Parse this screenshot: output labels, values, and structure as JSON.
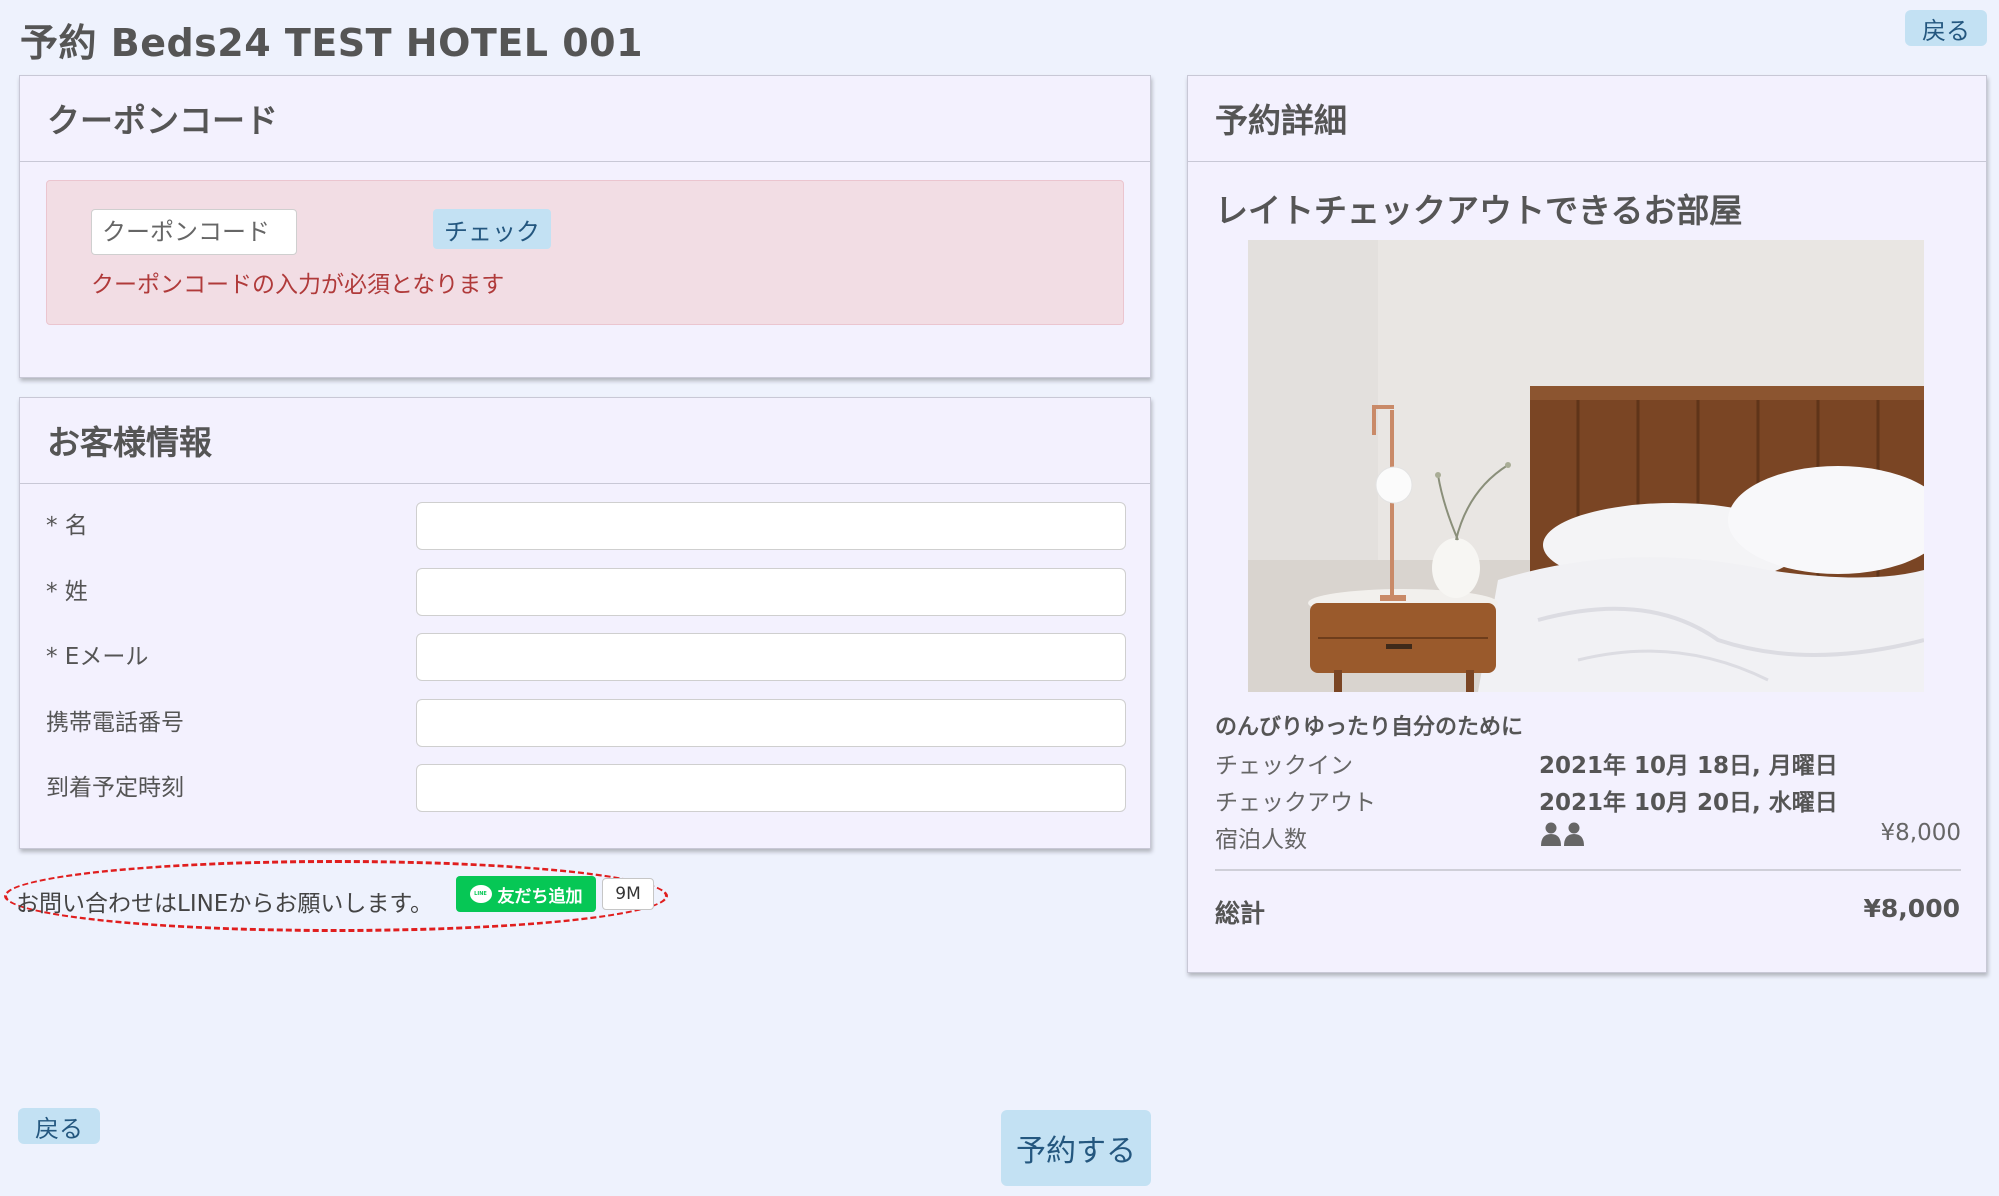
{
  "header": {
    "title": "予約 Beds24 TEST HOTEL 001",
    "back_label": "戻る"
  },
  "coupon": {
    "heading": "クーポンコード",
    "placeholder": "クーポンコード",
    "check_label": "チェック",
    "error": "クーポンコードの入力が必須となります"
  },
  "customer": {
    "heading": "お客様情報",
    "fields": [
      {
        "label": "* 名"
      },
      {
        "label": "* 姓"
      },
      {
        "label": "* Eメール"
      },
      {
        "label": "携帯電話番号"
      },
      {
        "label": "到着予定時刻"
      }
    ]
  },
  "line": {
    "text": "お問い合わせはLINEからお願いします。",
    "button_label": "友だち追加",
    "bubble_text": "LINE",
    "count": "9M"
  },
  "footer": {
    "back_label": "戻る",
    "submit_label": "予約する"
  },
  "details": {
    "heading": "予約詳細",
    "room_name": "レイトチェックアウトできるお部屋",
    "tagline": "のんびりゆったり自分のために",
    "checkin_label": "チェックイン",
    "checkin_value": "2021年 10月 18日, 月曜日",
    "checkout_label": "チェックアウト",
    "checkout_value": "2021年 10月 20日, 水曜日",
    "guests_label": "宿泊人数",
    "guests_price": "¥8,000",
    "total_label": "総計",
    "total_value": "¥8,000"
  },
  "colors": {
    "background": "#eef2fd",
    "panel": "#f3f1fe",
    "button": "#c3e1f3",
    "button_text": "#24577f",
    "alert_bg": "#f2dde4",
    "error_text": "#b03a3a",
    "line_green": "#06c755",
    "highlight_red": "#e01e1e"
  }
}
